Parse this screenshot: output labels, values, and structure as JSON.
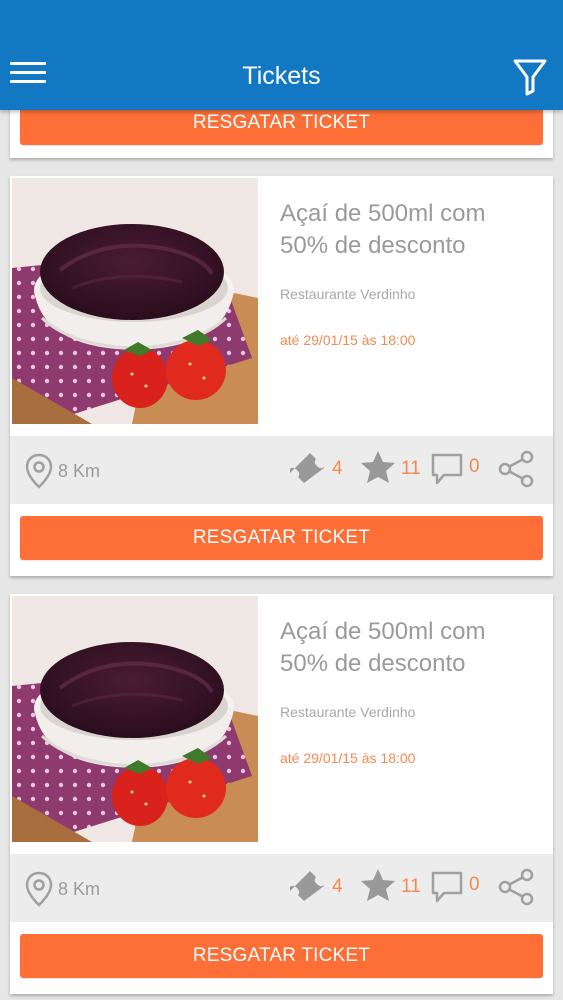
{
  "header": {
    "title": "Tickets",
    "menu_icon": "hamburger-menu-icon",
    "filter_icon": "filter-icon",
    "background_color": "#1378c4"
  },
  "partial_card": {
    "button_label": "RESGATAR TICKET"
  },
  "tickets": [
    {
      "title": "Açaí de 500ml com 50% de desconto",
      "restaurant": "Restaurante Verdinho",
      "deadline": "até 29/01/15 às 18:00",
      "distance": "8 Km",
      "tickets_count": "4",
      "stars_count": "11",
      "comments_count": "0",
      "button_label": "RESGATAR TICKET"
    },
    {
      "title": "Açaí de 500ml com 50% de desconto",
      "restaurant": "Restaurante Verdinho",
      "deadline": "até 29/01/15 às 18:00",
      "distance": "8 Km",
      "tickets_count": "4",
      "stars_count": "11",
      "comments_count": "0",
      "button_label": "RESGATAR TICKET"
    }
  ],
  "colors": {
    "accent": "#fd6f37",
    "deadline_text": "#f48a4f",
    "counts_text": "#f48a4f",
    "muted_text": "#9b9b9b"
  }
}
